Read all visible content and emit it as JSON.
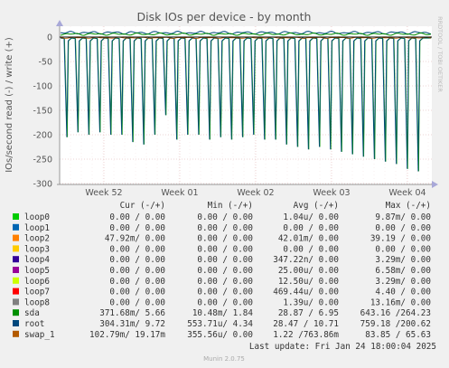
{
  "chart_data": {
    "type": "line",
    "title": "Disk IOs per device - by month",
    "ylabel": "IOs/second read (-) / write (+)",
    "side_label": "RRDTOOL / TOBI OETIKER",
    "ylim": [
      -300,
      10
    ],
    "y_ticks": [
      0,
      -50,
      -100,
      -150,
      -200,
      -250,
      -300
    ],
    "x_ticks": [
      "Week 52",
      "Week 01",
      "Week 02",
      "Week 03",
      "Week 04"
    ],
    "grid": true,
    "read_spike_depths": [
      -205,
      -195,
      -200,
      -195,
      -200,
      -200,
      -215,
      -220,
      -200,
      -160,
      -210,
      -200,
      -200,
      -210,
      -205,
      -210,
      -205,
      -200,
      -210,
      -210,
      -220,
      -225,
      -230,
      -225,
      -230,
      -235,
      -240,
      -245,
      -250,
      -255,
      -260,
      -270,
      -275
    ],
    "columns": [
      "Cur (-/+)",
      "Min (-/+)",
      "Avg (-/+)",
      "Max (-/+)"
    ],
    "series": [
      {
        "name": "loop0",
        "color": "#00cc00",
        "cur": "0.00 /  0.00",
        "min": "0.00 /  0.00",
        "avg": "1.04u/  0.00",
        "max": "9.87m/  0.00"
      },
      {
        "name": "loop1",
        "color": "#0066b3",
        "cur": "0.00 /  0.00",
        "min": "0.00 /  0.00",
        "avg": "0.00 /  0.00",
        "max": "0.00 /  0.00"
      },
      {
        "name": "loop2",
        "color": "#ff8000",
        "cur": "47.92m/  0.00",
        "min": "0.00 /  0.00",
        "avg": "42.01m/  0.00",
        "max": "39.19 /  0.00"
      },
      {
        "name": "loop3",
        "color": "#ffcc00",
        "cur": "0.00 /  0.00",
        "min": "0.00 /  0.00",
        "avg": "0.00 /  0.00",
        "max": "0.00 /  0.00"
      },
      {
        "name": "loop4",
        "color": "#330099",
        "cur": "0.00 /  0.00",
        "min": "0.00 /  0.00",
        "avg": "347.22n/  0.00",
        "max": "3.29m/  0.00"
      },
      {
        "name": "loop5",
        "color": "#990099",
        "cur": "0.00 /  0.00",
        "min": "0.00 /  0.00",
        "avg": "25.00u/  0.00",
        "max": "6.58m/  0.00"
      },
      {
        "name": "loop6",
        "color": "#ccff00",
        "cur": "0.00 /  0.00",
        "min": "0.00 /  0.00",
        "avg": "12.50u/  0.00",
        "max": "3.29m/  0.00"
      },
      {
        "name": "loop7",
        "color": "#ff0000",
        "cur": "0.00 /  0.00",
        "min": "0.00 /  0.00",
        "avg": "469.44u/  0.00",
        "max": "4.40 /  0.00"
      },
      {
        "name": "loop8",
        "color": "#808080",
        "cur": "0.00 /  0.00",
        "min": "0.00 /  0.00",
        "avg": "1.39u/  0.00",
        "max": "13.16m/  0.00"
      },
      {
        "name": "sda",
        "color": "#008f00",
        "cur": "371.68m/  5.66",
        "min": "10.48m/  1.84",
        "avg": "28.87 /  6.95",
        "max": "643.16 /264.23"
      },
      {
        "name": "root",
        "color": "#00487d",
        "cur": "304.31m/  9.72",
        "min": "553.71u/  4.34",
        "avg": "28.47 / 10.71",
        "max": "759.18 /200.62"
      },
      {
        "name": "swap_1",
        "color": "#b35a00",
        "cur": "102.79m/ 19.17m",
        "min": "355.56u/  0.00",
        "avg": "1.22 /763.86m",
        "max": "83.85 / 65.63"
      }
    ],
    "last_update": "Last update: Fri Jan 24 18:00:04 2025",
    "footer": "Munin 2.0.75"
  }
}
